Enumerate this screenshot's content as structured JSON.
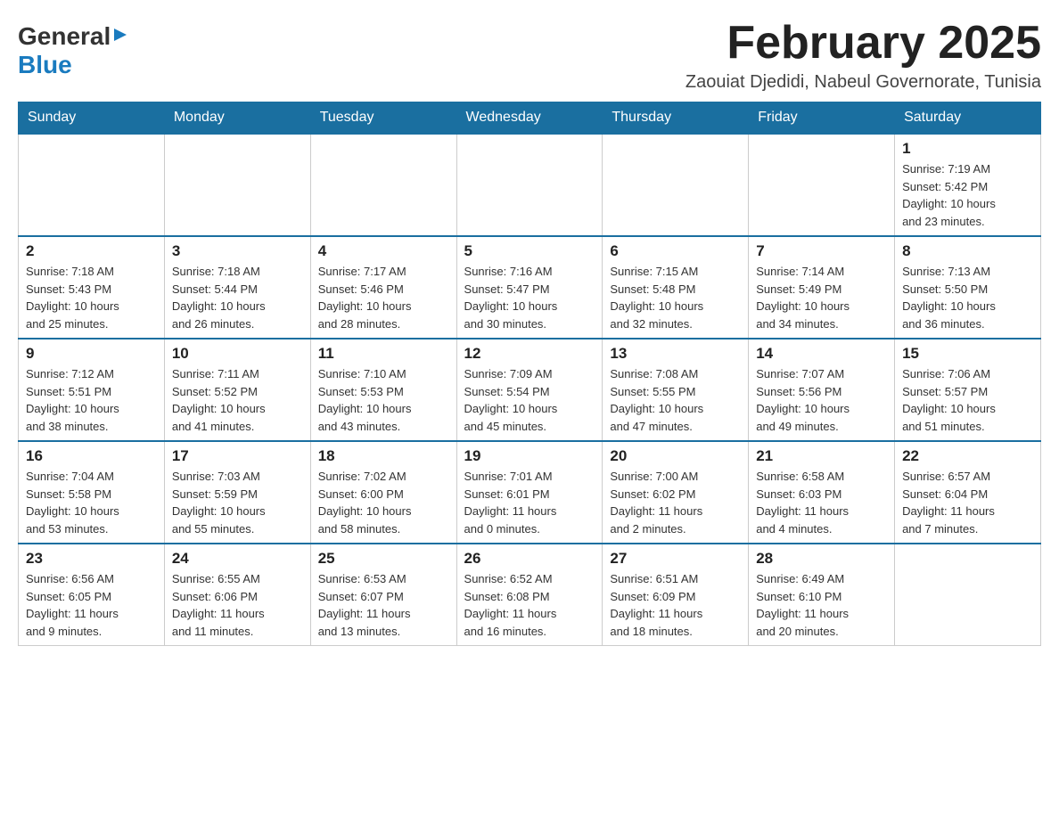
{
  "header": {
    "logo_general": "General",
    "logo_blue": "Blue",
    "month_title": "February 2025",
    "location": "Zaouiat Djedidi, Nabeul Governorate, Tunisia"
  },
  "days_of_week": [
    "Sunday",
    "Monday",
    "Tuesday",
    "Wednesday",
    "Thursday",
    "Friday",
    "Saturday"
  ],
  "weeks": [
    {
      "days": [
        {
          "date": "",
          "info": ""
        },
        {
          "date": "",
          "info": ""
        },
        {
          "date": "",
          "info": ""
        },
        {
          "date": "",
          "info": ""
        },
        {
          "date": "",
          "info": ""
        },
        {
          "date": "",
          "info": ""
        },
        {
          "date": "1",
          "info": "Sunrise: 7:19 AM\nSunset: 5:42 PM\nDaylight: 10 hours\nand 23 minutes."
        }
      ]
    },
    {
      "days": [
        {
          "date": "2",
          "info": "Sunrise: 7:18 AM\nSunset: 5:43 PM\nDaylight: 10 hours\nand 25 minutes."
        },
        {
          "date": "3",
          "info": "Sunrise: 7:18 AM\nSunset: 5:44 PM\nDaylight: 10 hours\nand 26 minutes."
        },
        {
          "date": "4",
          "info": "Sunrise: 7:17 AM\nSunset: 5:46 PM\nDaylight: 10 hours\nand 28 minutes."
        },
        {
          "date": "5",
          "info": "Sunrise: 7:16 AM\nSunset: 5:47 PM\nDaylight: 10 hours\nand 30 minutes."
        },
        {
          "date": "6",
          "info": "Sunrise: 7:15 AM\nSunset: 5:48 PM\nDaylight: 10 hours\nand 32 minutes."
        },
        {
          "date": "7",
          "info": "Sunrise: 7:14 AM\nSunset: 5:49 PM\nDaylight: 10 hours\nand 34 minutes."
        },
        {
          "date": "8",
          "info": "Sunrise: 7:13 AM\nSunset: 5:50 PM\nDaylight: 10 hours\nand 36 minutes."
        }
      ]
    },
    {
      "days": [
        {
          "date": "9",
          "info": "Sunrise: 7:12 AM\nSunset: 5:51 PM\nDaylight: 10 hours\nand 38 minutes."
        },
        {
          "date": "10",
          "info": "Sunrise: 7:11 AM\nSunset: 5:52 PM\nDaylight: 10 hours\nand 41 minutes."
        },
        {
          "date": "11",
          "info": "Sunrise: 7:10 AM\nSunset: 5:53 PM\nDaylight: 10 hours\nand 43 minutes."
        },
        {
          "date": "12",
          "info": "Sunrise: 7:09 AM\nSunset: 5:54 PM\nDaylight: 10 hours\nand 45 minutes."
        },
        {
          "date": "13",
          "info": "Sunrise: 7:08 AM\nSunset: 5:55 PM\nDaylight: 10 hours\nand 47 minutes."
        },
        {
          "date": "14",
          "info": "Sunrise: 7:07 AM\nSunset: 5:56 PM\nDaylight: 10 hours\nand 49 minutes."
        },
        {
          "date": "15",
          "info": "Sunrise: 7:06 AM\nSunset: 5:57 PM\nDaylight: 10 hours\nand 51 minutes."
        }
      ]
    },
    {
      "days": [
        {
          "date": "16",
          "info": "Sunrise: 7:04 AM\nSunset: 5:58 PM\nDaylight: 10 hours\nand 53 minutes."
        },
        {
          "date": "17",
          "info": "Sunrise: 7:03 AM\nSunset: 5:59 PM\nDaylight: 10 hours\nand 55 minutes."
        },
        {
          "date": "18",
          "info": "Sunrise: 7:02 AM\nSunset: 6:00 PM\nDaylight: 10 hours\nand 58 minutes."
        },
        {
          "date": "19",
          "info": "Sunrise: 7:01 AM\nSunset: 6:01 PM\nDaylight: 11 hours\nand 0 minutes."
        },
        {
          "date": "20",
          "info": "Sunrise: 7:00 AM\nSunset: 6:02 PM\nDaylight: 11 hours\nand 2 minutes."
        },
        {
          "date": "21",
          "info": "Sunrise: 6:58 AM\nSunset: 6:03 PM\nDaylight: 11 hours\nand 4 minutes."
        },
        {
          "date": "22",
          "info": "Sunrise: 6:57 AM\nSunset: 6:04 PM\nDaylight: 11 hours\nand 7 minutes."
        }
      ]
    },
    {
      "days": [
        {
          "date": "23",
          "info": "Sunrise: 6:56 AM\nSunset: 6:05 PM\nDaylight: 11 hours\nand 9 minutes."
        },
        {
          "date": "24",
          "info": "Sunrise: 6:55 AM\nSunset: 6:06 PM\nDaylight: 11 hours\nand 11 minutes."
        },
        {
          "date": "25",
          "info": "Sunrise: 6:53 AM\nSunset: 6:07 PM\nDaylight: 11 hours\nand 13 minutes."
        },
        {
          "date": "26",
          "info": "Sunrise: 6:52 AM\nSunset: 6:08 PM\nDaylight: 11 hours\nand 16 minutes."
        },
        {
          "date": "27",
          "info": "Sunrise: 6:51 AM\nSunset: 6:09 PM\nDaylight: 11 hours\nand 18 minutes."
        },
        {
          "date": "28",
          "info": "Sunrise: 6:49 AM\nSunset: 6:10 PM\nDaylight: 11 hours\nand 20 minutes."
        },
        {
          "date": "",
          "info": ""
        }
      ]
    }
  ],
  "colors": {
    "header_bg": "#1a6fa0",
    "header_text": "#ffffff",
    "border": "#cccccc",
    "accent": "#1a7bbf"
  }
}
